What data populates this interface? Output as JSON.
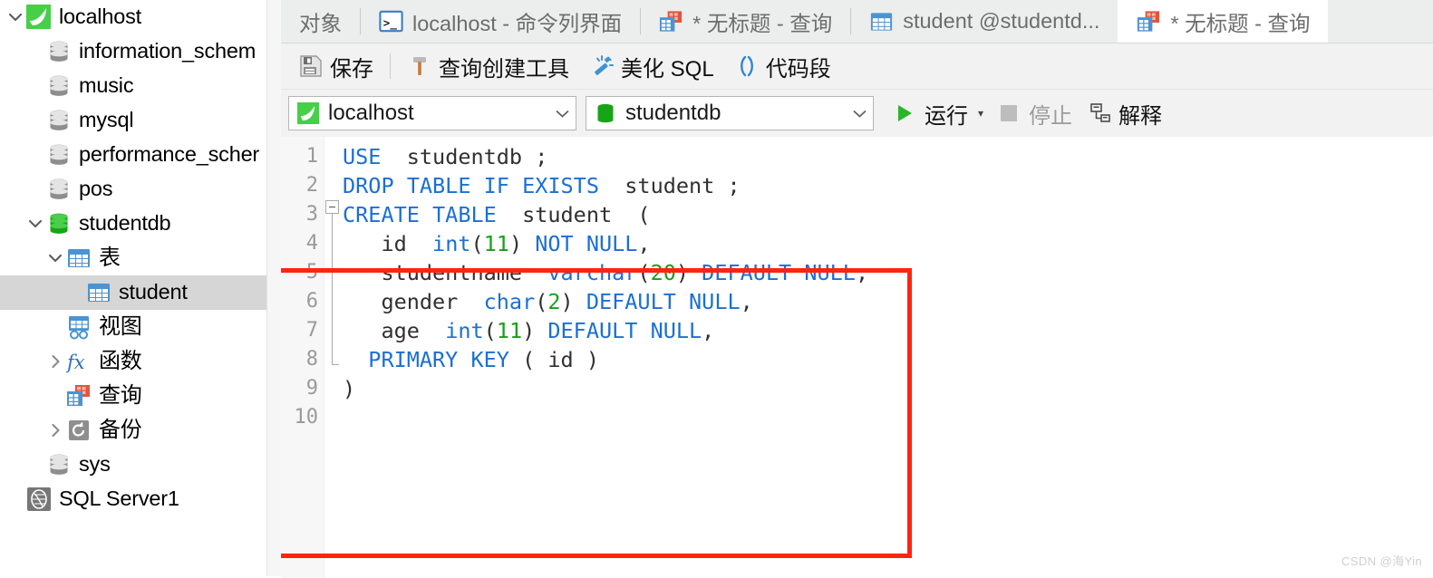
{
  "sidebar": {
    "items": [
      {
        "label": "localhost",
        "icon": "dolphin-icon",
        "indent": 0,
        "twisty": "down",
        "selected": false
      },
      {
        "label": "information_schem",
        "icon": "database-gray-icon",
        "indent": 1,
        "twisty": "none",
        "selected": false
      },
      {
        "label": "music",
        "icon": "database-gray-icon",
        "indent": 1,
        "twisty": "none",
        "selected": false
      },
      {
        "label": "mysql",
        "icon": "database-gray-icon",
        "indent": 1,
        "twisty": "none",
        "selected": false
      },
      {
        "label": "performance_scher",
        "icon": "database-gray-icon",
        "indent": 1,
        "twisty": "none",
        "selected": false
      },
      {
        "label": "pos",
        "icon": "database-gray-icon",
        "indent": 1,
        "twisty": "none",
        "selected": false
      },
      {
        "label": "studentdb",
        "icon": "database-green-icon",
        "indent": 1,
        "twisty": "down",
        "selected": false
      },
      {
        "label": "表",
        "icon": "table-folder-icon",
        "indent": 2,
        "twisty": "down",
        "selected": false
      },
      {
        "label": "student",
        "icon": "table-icon",
        "indent": 3,
        "twisty": "none",
        "selected": true
      },
      {
        "label": "视图",
        "icon": "view-icon",
        "indent": 2,
        "twisty": "none",
        "selected": false
      },
      {
        "label": "函数",
        "icon": "function-icon",
        "indent": 2,
        "twisty": "right",
        "selected": false
      },
      {
        "label": "查询",
        "icon": "query-icon",
        "indent": 2,
        "twisty": "none",
        "selected": false
      },
      {
        "label": "备份",
        "icon": "backup-icon",
        "indent": 2,
        "twisty": "right",
        "selected": false
      },
      {
        "label": "sys",
        "icon": "database-gray-icon",
        "indent": 1,
        "twisty": "none",
        "selected": false
      },
      {
        "label": "SQL Server1",
        "icon": "sqlserver-icon",
        "indent": 0,
        "twisty": "none",
        "selected": false
      }
    ]
  },
  "tabs": [
    {
      "label": "对象",
      "icon": "none",
      "active": false
    },
    {
      "label": "localhost - 命令列界面",
      "icon": "console-icon",
      "active": false
    },
    {
      "label": "* 无标题 - 查询",
      "icon": "query-icon",
      "active": false
    },
    {
      "label": "student @studentd...",
      "icon": "table-icon",
      "active": false
    },
    {
      "label": "* 无标题 - 查询",
      "icon": "query-icon",
      "active": true
    }
  ],
  "toolbar": {
    "save_label": "保存",
    "query_builder_label": "查询创建工具",
    "beautify_label": "美化 SQL",
    "snippet_label": "代码段"
  },
  "connection": {
    "host": "localhost",
    "database": "studentdb",
    "run_label": "运行",
    "stop_label": "停止",
    "explain_label": "解释"
  },
  "editor": {
    "line_numbers": [
      "1",
      "2",
      "3",
      "4",
      "5",
      "6",
      "7",
      "8",
      "9",
      "10"
    ],
    "lines": [
      [
        {
          "t": "USE  ",
          "c": "kw"
        },
        {
          "t": "studentdb ;",
          "c": "id"
        }
      ],
      [
        {
          "t": "DROP TABLE IF EXISTS ",
          "c": "kw"
        },
        {
          "t": " student ;",
          "c": "id"
        }
      ],
      [
        {
          "t": "CREATE TABLE ",
          "c": "kw"
        },
        {
          "t": " student  (",
          "c": "id"
        }
      ],
      [
        {
          "t": "   id  ",
          "c": "id"
        },
        {
          "t": "int",
          "c": "kw"
        },
        {
          "t": "(",
          "c": "pun"
        },
        {
          "t": "11",
          "c": "num"
        },
        {
          "t": ") ",
          "c": "pun"
        },
        {
          "t": "NOT NULL",
          "c": "kw"
        },
        {
          "t": ",",
          "c": "pun"
        }
      ],
      [
        {
          "t": "   studentname  ",
          "c": "id"
        },
        {
          "t": "varchar",
          "c": "kw"
        },
        {
          "t": "(",
          "c": "pun"
        },
        {
          "t": "20",
          "c": "num"
        },
        {
          "t": ") ",
          "c": "pun"
        },
        {
          "t": "DEFAULT NULL",
          "c": "kw"
        },
        {
          "t": ",",
          "c": "pun"
        }
      ],
      [
        {
          "t": "   gender  ",
          "c": "id"
        },
        {
          "t": "char",
          "c": "kw"
        },
        {
          "t": "(",
          "c": "pun"
        },
        {
          "t": "2",
          "c": "num"
        },
        {
          "t": ") ",
          "c": "pun"
        },
        {
          "t": "DEFAULT NULL",
          "c": "kw"
        },
        {
          "t": ",",
          "c": "pun"
        }
      ],
      [
        {
          "t": "   age  ",
          "c": "id"
        },
        {
          "t": "int",
          "c": "kw"
        },
        {
          "t": "(",
          "c": "pun"
        },
        {
          "t": "11",
          "c": "num"
        },
        {
          "t": ") ",
          "c": "pun"
        },
        {
          "t": "DEFAULT NULL",
          "c": "kw"
        },
        {
          "t": ",",
          "c": "pun"
        }
      ],
      [
        {
          "t": "  ",
          "c": "id"
        },
        {
          "t": "PRIMARY KEY",
          "c": "kw"
        },
        {
          "t": " ( id )",
          "c": "id"
        }
      ],
      [
        {
          "t": ")",
          "c": "id"
        }
      ],
      [
        {
          "t": "",
          "c": "id"
        }
      ]
    ]
  },
  "watermark": "CSDN @海Yin",
  "colors": {
    "accent_red": "#ff2512",
    "keyword_blue": "#1b6fd4",
    "number_green": "#16a016",
    "selection_gray": "#d6d6d6"
  }
}
